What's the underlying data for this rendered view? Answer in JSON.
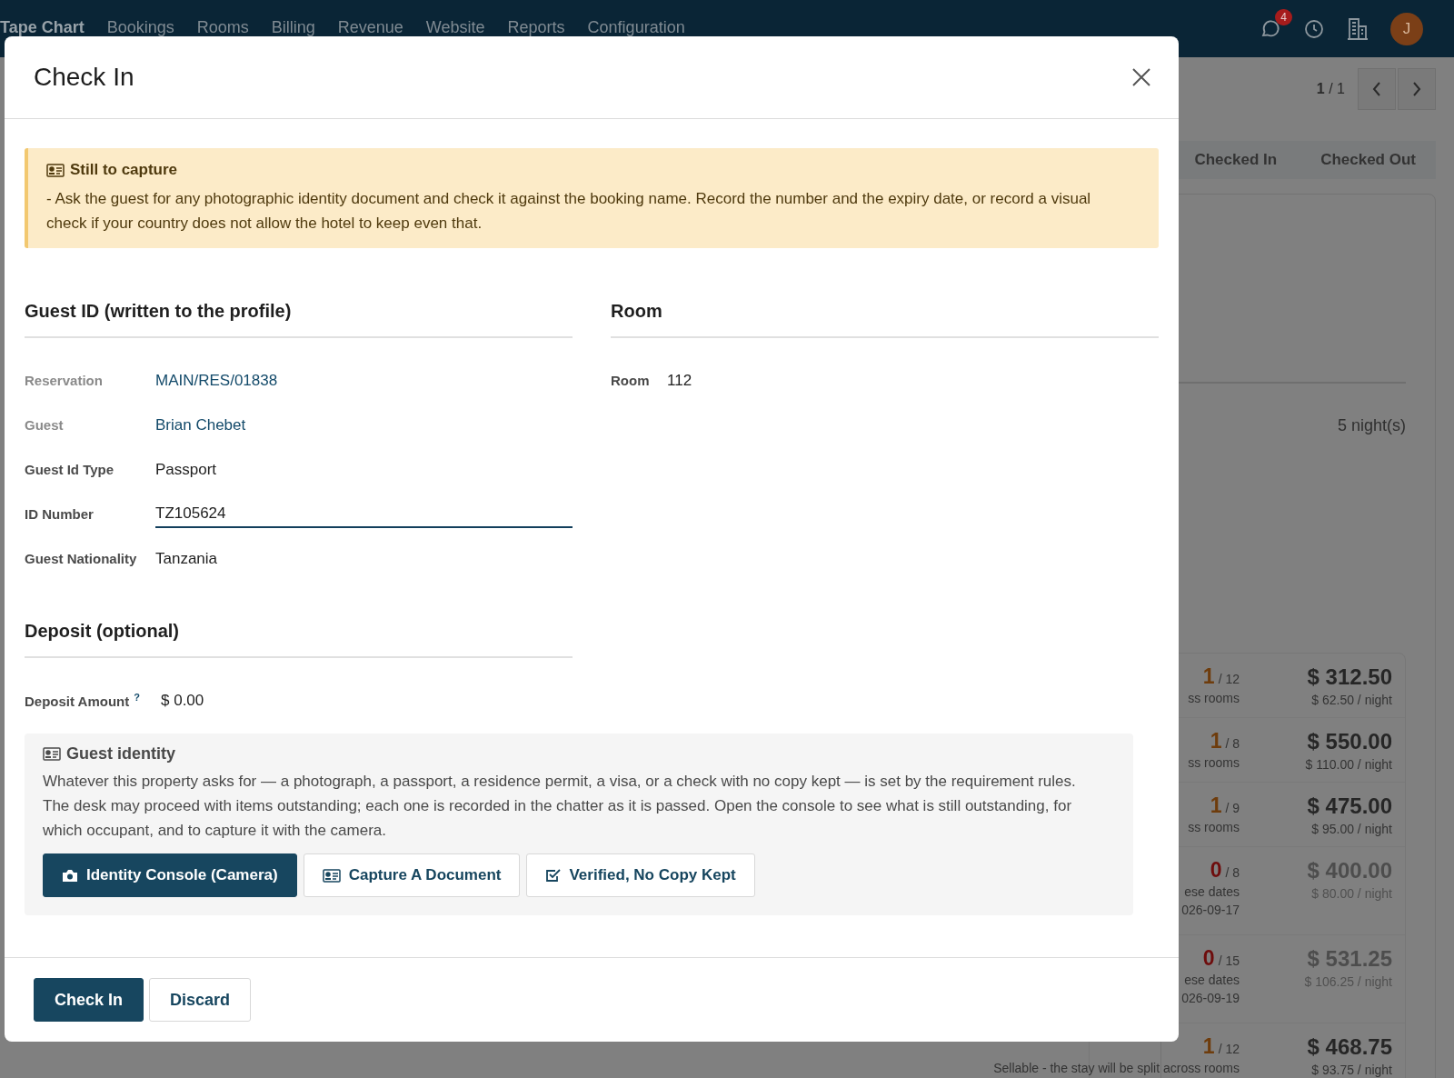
{
  "top_nav": {
    "items": [
      {
        "label": "Tape Chart",
        "selected": true
      },
      {
        "label": "Bookings",
        "selected": false
      },
      {
        "label": "Rooms",
        "selected": false
      },
      {
        "label": "Billing",
        "selected": false
      },
      {
        "label": "Revenue",
        "selected": false
      },
      {
        "label": "Website",
        "selected": false
      },
      {
        "label": "Reports",
        "selected": false
      },
      {
        "label": "Configuration",
        "selected": false
      }
    ],
    "message_count": "4",
    "avatar_initial": "J"
  },
  "pager": {
    "counter": "**1** / 1"
  },
  "status_steps": [
    {
      "label": "Checked In",
      "selected": false
    },
    {
      "label": "Checked Out",
      "selected": false
    }
  ],
  "stay": {
    "nights": "5 night(s)"
  },
  "offers": [
    {
      "available": "1",
      "total": "/ 12",
      "note": "ss rooms",
      "price": "$ 312.50",
      "per_night": "$ 62.50 / night",
      "sellable": true
    },
    {
      "available": "1",
      "total": "/ 8",
      "note": "ss rooms",
      "price": "$ 550.00",
      "per_night": "$ 110.00 / night",
      "sellable": true
    },
    {
      "available": "1",
      "total": "/ 9",
      "note": "ss rooms",
      "price": "$ 475.00",
      "per_night": "$ 95.00 / night",
      "sellable": true
    },
    {
      "available": "0",
      "total": "/ 8",
      "note": "ese dates",
      "date": "026-09-17",
      "price": "$ 400.00",
      "per_night": "$ 80.00 / night",
      "sellable": false
    },
    {
      "available": "0",
      "total": "/ 15",
      "note": "ese dates",
      "date": "026-09-19",
      "price": "$ 531.25",
      "per_night": "$ 106.25 / night",
      "sellable": false
    },
    {
      "available": "1",
      "total": "/ 12",
      "note": "Sellable - the stay will be split across rooms",
      "price": "$ 468.75",
      "per_night": "$ 93.75 / night",
      "sellable": true
    }
  ],
  "dialog": {
    "title": "Check In",
    "alert": {
      "title": "Still to capture",
      "text": "- Ask the guest for any photographic identity document and check it against the booking name. Record the number and the expiry date, or record a visual check if your country does not allow the hotel to keep even that."
    },
    "guest_section": {
      "title": "Guest ID (written to the profile)",
      "fields": [
        {
          "label": "Reservation",
          "value": "MAIN/RES/01838",
          "kind": "link"
        },
        {
          "label": "Guest",
          "value": "Brian Chebet",
          "kind": "link"
        },
        {
          "label": "Guest Id Type",
          "value": "Passport",
          "kind": "text"
        },
        {
          "label": "ID Number",
          "value": "TZ105624",
          "kind": "input"
        },
        {
          "label": "Guest Nationality",
          "value": "Tanzania",
          "kind": "text"
        }
      ]
    },
    "room_section": {
      "title": "Room",
      "fields": [
        {
          "label": "Room",
          "value": "112",
          "kind": "text"
        }
      ]
    },
    "deposit_section": {
      "title": "Deposit (optional)",
      "label": "Deposit Amount",
      "help_mark": "?",
      "value": "$ 0.00"
    },
    "identity": {
      "title": "Guest identity",
      "text": "Whatever this property asks for — a photograph, a passport, a residence permit, a visa, or a check with no copy kept — is set by the requirement rules. The desk may proceed with items outstanding; each one is recorded in the chatter as it is passed. Open the console to see what is still outstanding, for which occupant, and to capture it with the camera.",
      "buttons": [
        {
          "label": "Identity Console (Camera)",
          "kind": "primary"
        },
        {
          "label": "Capture A Document",
          "kind": "secondary"
        },
        {
          "label": "Verified, No Copy Kept",
          "kind": "secondary"
        }
      ]
    },
    "footer_buttons": [
      {
        "label": "Check In",
        "kind": "primary"
      },
      {
        "label": "Discard",
        "kind": "secondary"
      }
    ]
  }
}
